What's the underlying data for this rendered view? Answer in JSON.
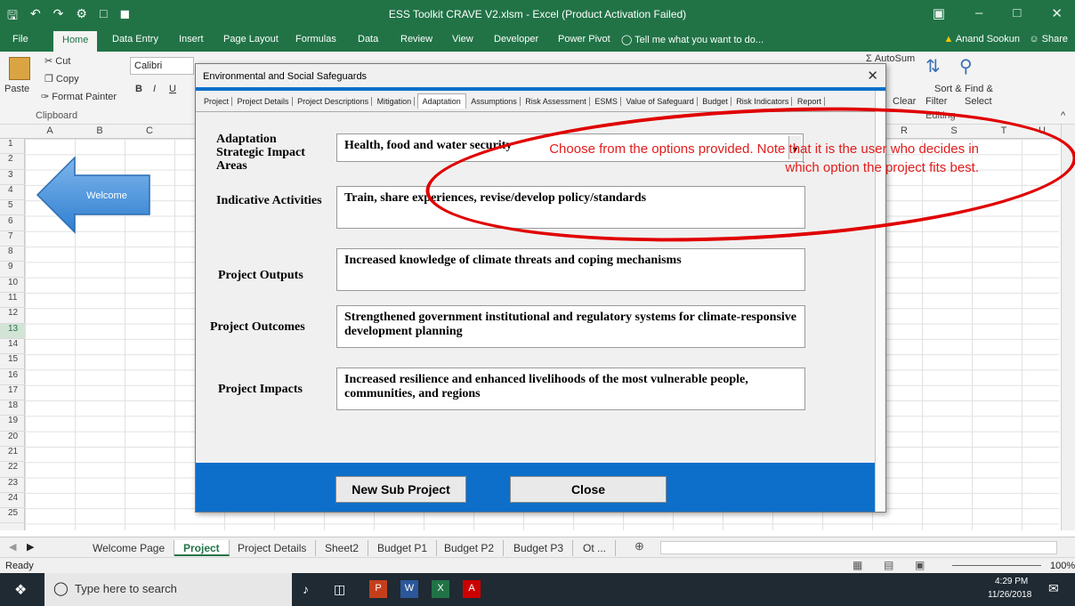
{
  "window": {
    "title": "ESS Toolkit CRAVE V2.xlsm - Excel (Product Activation Failed)"
  },
  "ribbon_tabs": [
    "File",
    "Home",
    "Data Entry",
    "Insert",
    "Page Layout",
    "Formulas",
    "Data",
    "Review",
    "View",
    "Developer",
    "Power Pivot"
  ],
  "tell_me": "Tell me what you want to do...",
  "user": "Anand Sookun",
  "share": "Share",
  "ribbon": {
    "cut": "Cut",
    "copy": "Copy",
    "paste": "Paste",
    "format_painter": "Format Painter",
    "clipboard": "Clipboard",
    "font": "Calibri",
    "autosum": "AutoSum",
    "sort": "Sort &",
    "filter": "Filter",
    "find": "Find &",
    "select": "Select",
    "clear": "Clear",
    "editing": "Editing"
  },
  "columns": [
    "A",
    "B",
    "C",
    "R",
    "S",
    "T",
    "U"
  ],
  "rows": [
    "1",
    "2",
    "3",
    "4",
    "5",
    "6",
    "7",
    "8",
    "9",
    "10",
    "11",
    "12",
    "13",
    "14",
    "15",
    "16",
    "17",
    "18",
    "19",
    "20",
    "21",
    "22",
    "23",
    "24",
    "25"
  ],
  "shape_label": "Welcome",
  "dialog": {
    "title": "Environmental and Social Safeguards",
    "tabs": [
      "Project",
      "Project Details",
      "Project Descriptions",
      "Mitigation",
      "Adaptation",
      "Assumptions",
      "Risk Assessment",
      "ESMS",
      "Value of Safeguard",
      "Budget",
      "Risk Indicators",
      "Report"
    ],
    "fields": {
      "strategic_label": "Adaptation Strategic Impact Areas",
      "strategic_value": "Health, food and water security",
      "activities_label": "Indicative Activities",
      "activities_value": "Train, share experiences, revise/develop policy/standards",
      "outputs_label": "Project Outputs",
      "outputs_value": "Increased knowledge of climate threats and coping mechanisms",
      "outcomes_label": "Project Outcomes",
      "outcomes_value": "Strengthened government institutional and regulatory systems for climate-responsive development planning",
      "impacts_label": "Project Impacts",
      "impacts_value": "Increased resilience and enhanced livelihoods of the most vulnerable people, communities, and regions"
    },
    "new_sub_project": "New Sub Project",
    "close": "Close"
  },
  "annotation": "Choose from the options provided. Note that it is the user who decides in which option the project fits best.",
  "sheet_tabs": [
    "Welcome Page",
    "Project",
    "Project Details",
    "Sheet2",
    "Budget P1",
    "Budget P2",
    "Budget P3",
    "Ot ..."
  ],
  "status": {
    "ready": "Ready",
    "zoom": "100%"
  },
  "taskbar": {
    "search": "Type here to search",
    "time": "4:29 PM",
    "date": "11/26/2018"
  },
  "colors": {
    "excel_green": "#217346",
    "dialog_blue": "#0d6fc9",
    "annotation_red": "#e31b1b"
  }
}
